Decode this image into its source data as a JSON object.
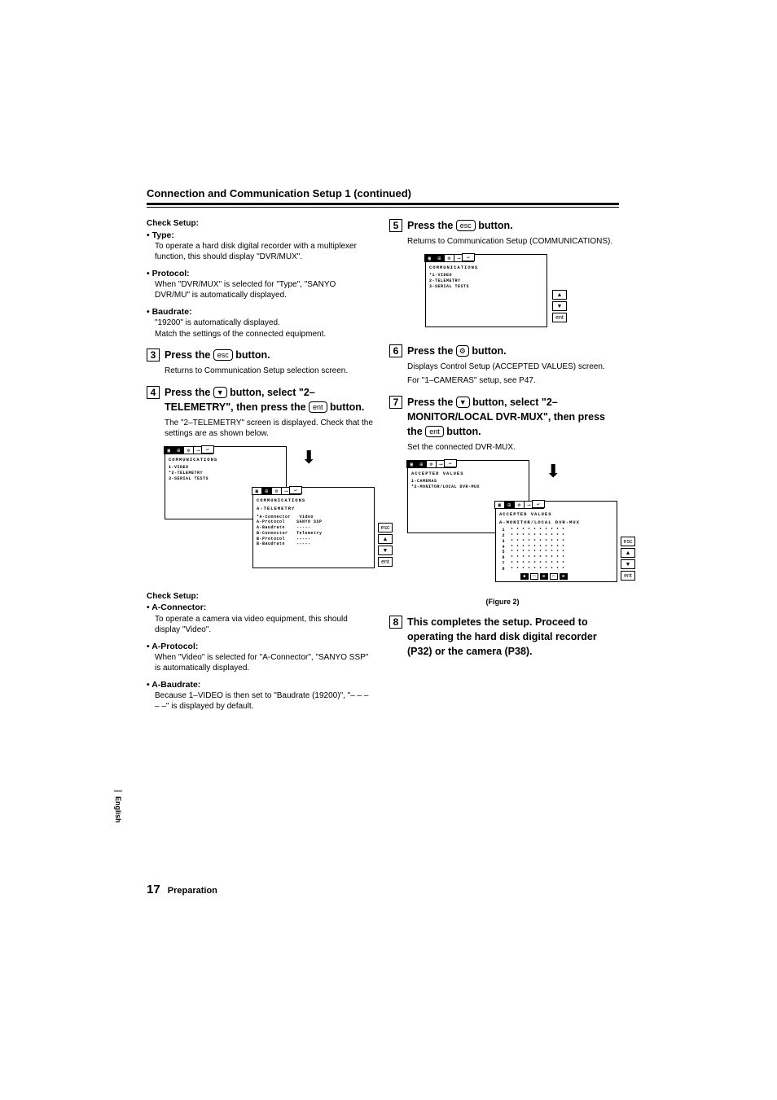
{
  "header": {
    "title": "Connection and Communication Setup 1  (continued)"
  },
  "left": {
    "check1_title": "Check Setup:",
    "type_head": "Type:",
    "type_body": "To operate a hard disk digital recorder with a multiplexer function, this should display \"DVR/MUX\".",
    "proto_head": "Protocol:",
    "proto_body": "When \"DVR/MUX\" is selected for \"Type\", \"SANYO DVR/MU\" is automatically displayed.",
    "baud_head": "Baudrate:",
    "baud_body1": "\"19200\" is automatically displayed.",
    "baud_body2": "Match the settings of the connected equipment.",
    "step3_num": "3",
    "step3_text_a": "Press the ",
    "step3_key": "esc",
    "step3_text_b": " button.",
    "step3_body": "Returns to Communication Setup selection screen.",
    "step4_num": "4",
    "step4_text_a": "Press the ",
    "step4_key": "▼",
    "step4_text_b": " button, select \"2–TELEMETRY\", then press the ",
    "step4_key2": "ent",
    "step4_text_c": " button.",
    "step4_body": "The \"2–TELEMETRY\" screen is displayed. Check that the settings are as shown below.",
    "screen1": {
      "title": "COMMUNICATIONS",
      "l1": "1-VIDEO",
      "l2": "*2-TELEMETRY",
      "l3": "3-SERIAL TESTS"
    },
    "screen2": {
      "title": "COMMUNICATIONS",
      "sub": "A-TELEMETRY",
      "r1a": "*A-Connector",
      "r1b": "Video",
      "r2a": " A-Protocol",
      "r2b": "SANYO SSP",
      "r3a": " A-Baudrate",
      "r3b": "-----",
      "r4a": " B-Connector",
      "r4b": "Telemetry",
      "r5a": " B-Protocol",
      "r5b": "-----",
      "r6a": " B-Baudrate",
      "r6b": "-----"
    },
    "keys2": {
      "esc": "esc",
      "up": "▲",
      "down": "▼",
      "ent": "ent"
    },
    "check2_title": "Check Setup:",
    "aconn_head": "A-Connector:",
    "aconn_body": "To operate a camera via video equipment, this should display \"Video\".",
    "aproto_head": "A-Protocol:",
    "aproto_body": "When \"Video\" is selected for \"A-Connector\", \"SANYO SSP\" is automatically displayed.",
    "abaud_head": "A-Baudrate:",
    "abaud_body": "Because 1–VIDEO is then set to \"Baudrate (19200)\", \"– – – – –\" is displayed by default."
  },
  "right": {
    "step5_num": "5",
    "step5_text_a": "Press the ",
    "step5_key": "esc",
    "step5_text_b": " button.",
    "step5_body": "Returns to Communication Setup (COMMUNICATIONS).",
    "screen5": {
      "title": "COMMUNICATIONS",
      "l1": "*1-VIDEO",
      "l2": " 2-TELEMETRY",
      "l3": " 3-SERIAL TESTS"
    },
    "keys5": {
      "up": "▲",
      "down": "▼",
      "ent": "ent"
    },
    "step6_num": "6",
    "step6_text_a": "Press the ",
    "step6_icon": "⚙",
    "step6_text_b": " button.",
    "step6_body1": "Displays Control Setup (ACCEPTED VALUES) screen.",
    "step6_body2": "For \"1–CAMERAS\" setup, see P47.",
    "step7_num": "7",
    "step7_text_a": "Press the ",
    "step7_key": "▼",
    "step7_text_b": " button, select \"2–MONITOR/LOCAL DVR-MUX\", then press the ",
    "step7_key2": "ent",
    "step7_text_c": " button.",
    "step7_body": "Set the connected DVR-MUX.",
    "screen7a": {
      "title": "ACCEPTED VALUES",
      "l1": " 1-CAMERAS",
      "l2": "*2-MONITOR/LOCAL DVR-MUX"
    },
    "screen7b": {
      "title": "ACCEPTED VALUES",
      "sub": "A-MONITOR/LOCAL DVR-MUX"
    },
    "keys7": {
      "esc": "esc",
      "up": "▲",
      "down": "▼",
      "ent": "ent"
    },
    "caption": "(Figure 2)",
    "step8_num": "8",
    "step8_text": "This completes the setup. Proceed to operating the hard disk digital recorder (P32) or the camera (P38)."
  },
  "footer": {
    "num": "17",
    "label": "Preparation"
  },
  "side": {
    "label": "English"
  }
}
